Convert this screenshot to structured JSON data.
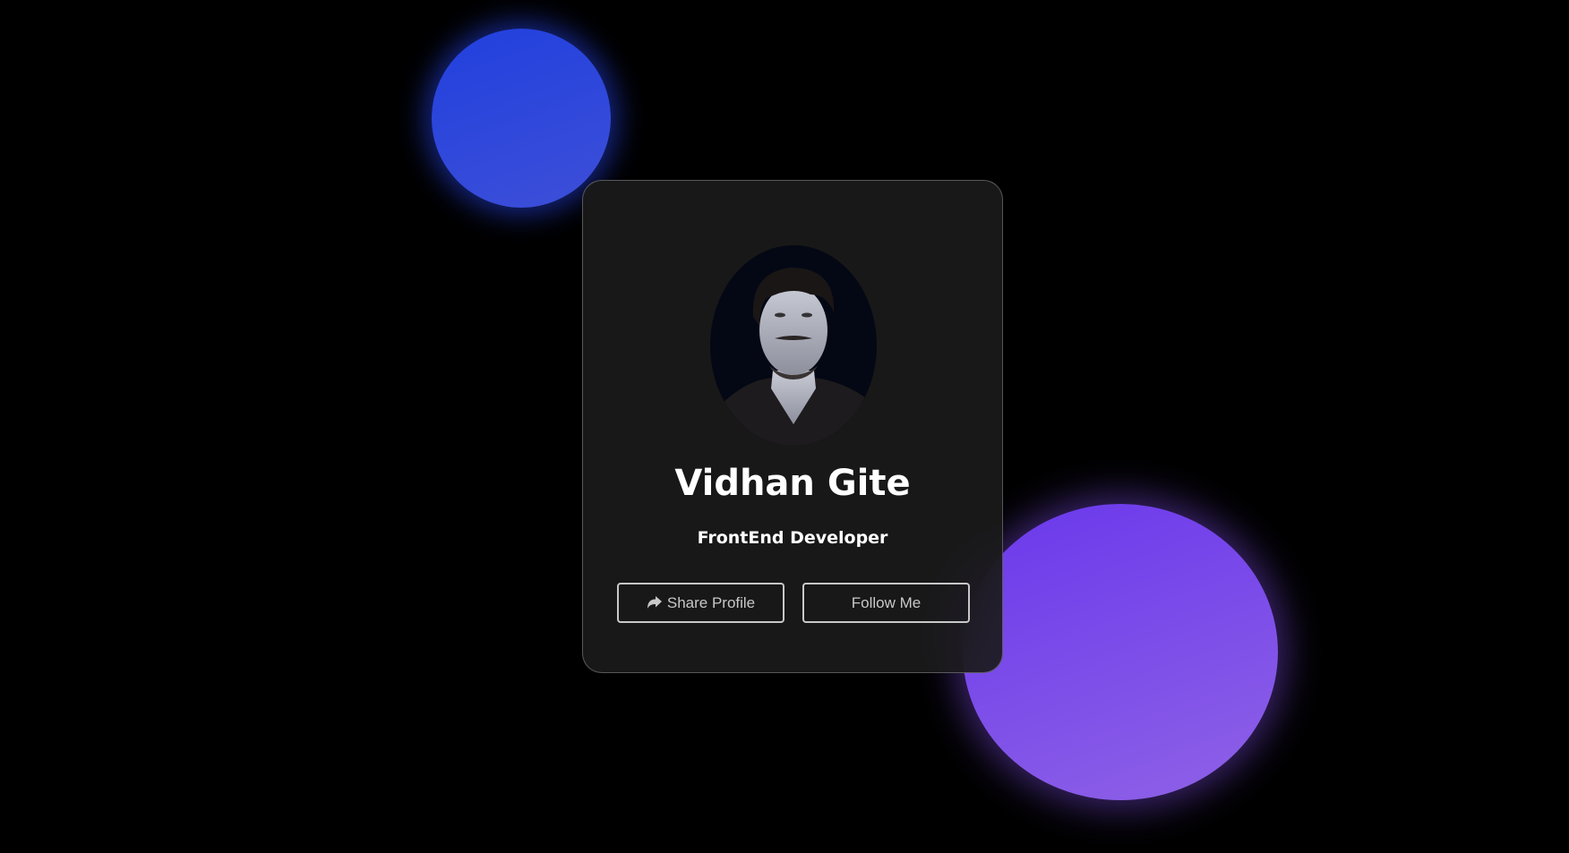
{
  "profile": {
    "name": "Vidhan Gite",
    "role": "FrontEnd Developer",
    "avatar_icon": "profile-photo"
  },
  "buttons": {
    "share_label": "Share Profile",
    "share_icon": "share-arrow-icon",
    "follow_label": "Follow Me"
  },
  "colors": {
    "blue_blob": "#2140de",
    "purple_blob": "#7a4ae8",
    "card_bg": "#1b1b1b"
  }
}
